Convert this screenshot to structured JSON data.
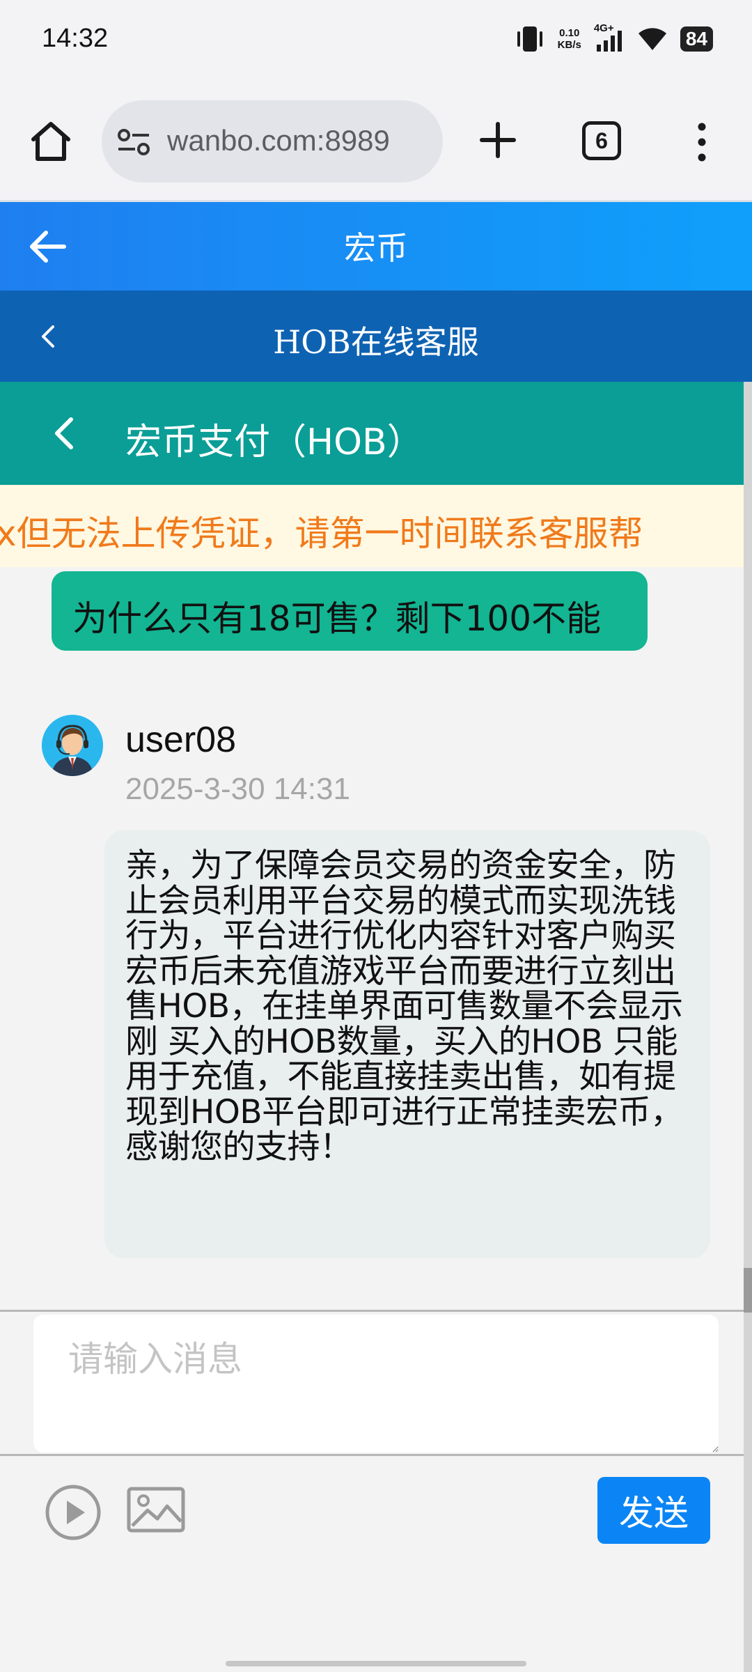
{
  "status_bar": {
    "time": "14:32",
    "net_speed_value": "0.10",
    "net_speed_unit": "KB/s",
    "network": "4G+",
    "battery": "84"
  },
  "browser": {
    "url": "wanbo.com:8989",
    "tab_count": "6"
  },
  "app_header": {
    "title": "宏币"
  },
  "service_header": {
    "title": "HOB在线客服"
  },
  "pay_header": {
    "title": "宏币支付（HOB）"
  },
  "notice": {
    "text": "x但无法上传凭证，请第一时间联系客服帮"
  },
  "chat": {
    "quick_question": "为什么只有18可售？剩下100不能",
    "sender_name": "user08",
    "sent_at": "2025-3-30 14:31",
    "message": "亲，为了保障会员交易的资金安全，防止会员利用平台交易的模式而实现洗钱行为，平台进行优化内容针对客户购买宏币后未充值游戏平台而要进行立刻出售HOB，在挂单界面可售数量不会显示刚 买入的HOB数量，买入的HOB 只能用于充值，不能直接挂卖出售，如有提现到HOB平台即可进行正常挂卖宏币，感谢您的支持！"
  },
  "input": {
    "placeholder": "请输入消息"
  },
  "toolbar": {
    "send_label": "发送"
  },
  "colors": {
    "app_header_start": "#1f7ff0",
    "app_header_end": "#0fa0fb",
    "service_header": "#0e62b2",
    "pay_header": "#0a9e96",
    "notice_text": "#f07a1b",
    "quick_bubble": "#13b592",
    "send_button": "#0b85f5"
  },
  "icons": [
    "vibrate-icon",
    "signal-icon",
    "wifi-icon",
    "home-icon",
    "site-settings-icon",
    "new-tab-icon",
    "tabs-icon",
    "more-menu-icon",
    "back-arrow-icon",
    "chevron-left-icon",
    "avatar",
    "play-icon",
    "image-icon"
  ]
}
